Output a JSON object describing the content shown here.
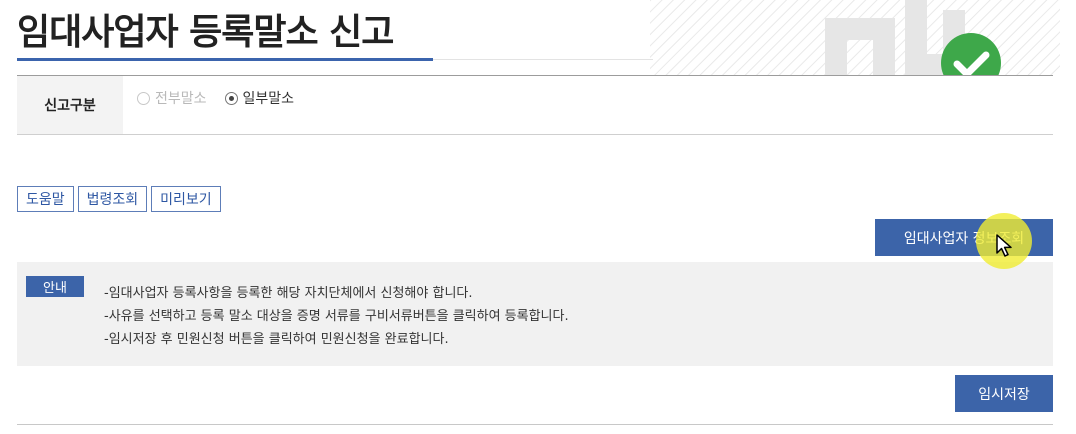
{
  "page": {
    "title": "임대사업자 등록말소 신고"
  },
  "report_type": {
    "label": "신고구분",
    "options": [
      {
        "label": "전부말소",
        "checked": false,
        "disabled": true
      },
      {
        "label": "일부말소",
        "checked": true,
        "disabled": false
      }
    ]
  },
  "toolbar": {
    "help_label": "도움말",
    "law_label": "법령조회",
    "preview_label": "미리보기"
  },
  "actions": {
    "lookup_label": "임대사업자 정보조회",
    "temp_save_label": "임시저장"
  },
  "notice": {
    "badge": "안내",
    "lines": [
      "-임대사업자 등록사항을 등록한 해당 자치단체에서 신청해야 합니다.",
      "-사유를 선택하고 등록 말소 대상을 증명 서류를 구비서류버튼을 클릭하여 등록합니다.",
      "-임시저장 후 민원신청 버튼을 클릭하여 민원신청을 완료합니다."
    ]
  },
  "colors": {
    "primary": "#3c64a9",
    "check_green": "#3ea84a",
    "highlight": "#f0ec32"
  },
  "icons": {
    "banner_check": "check-circle-icon",
    "cursor": "mouse-cursor-icon"
  }
}
